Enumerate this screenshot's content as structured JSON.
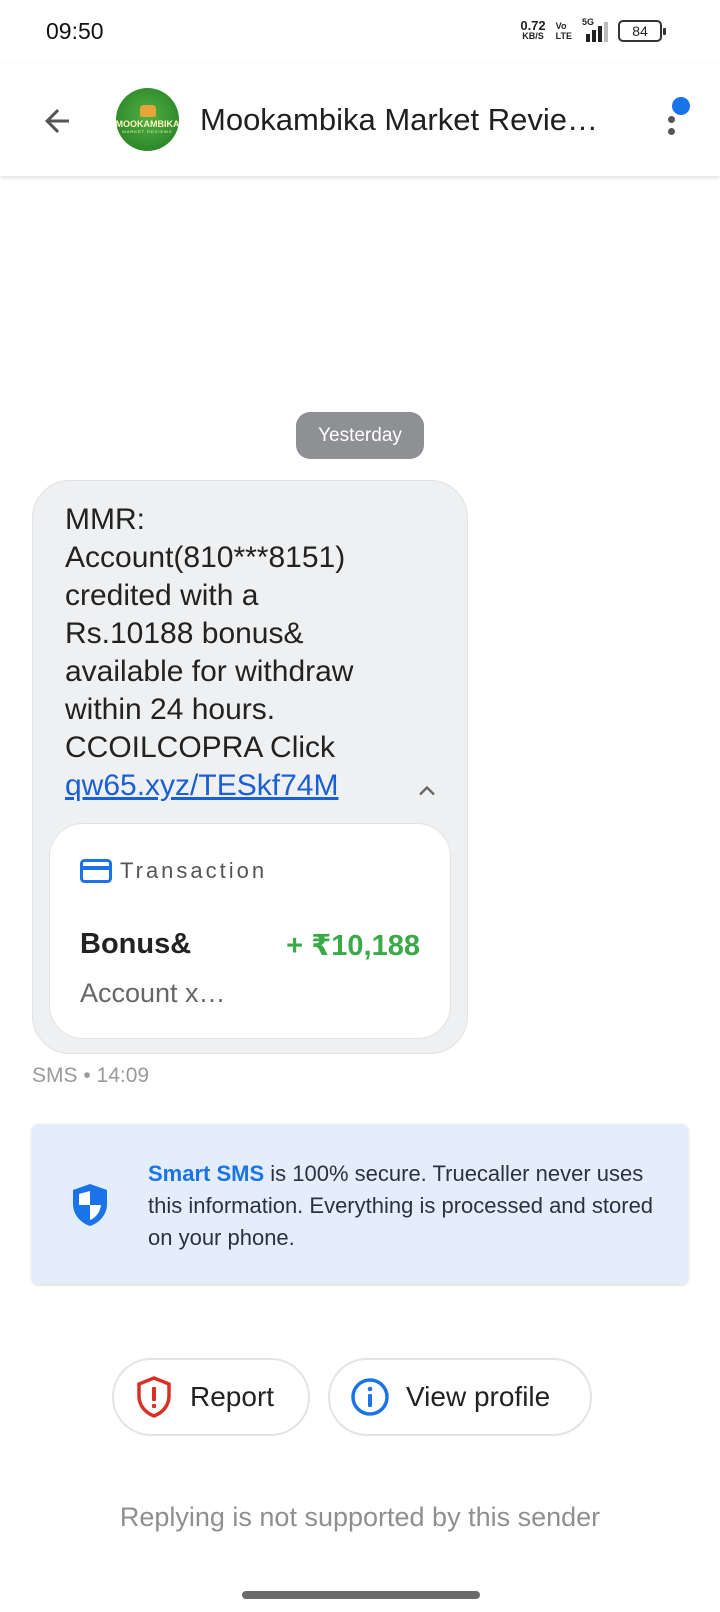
{
  "status_bar": {
    "time": "09:50",
    "net_speed": "0.72",
    "net_unit": "KB/S",
    "volte_top": "Vo",
    "volte_bottom": "LTE",
    "network": "5G",
    "battery": "84"
  },
  "header": {
    "contact_name": "Mookambika Market Revie…",
    "avatar_text": "MOOKAMBIKA",
    "avatar_subtext": "MARKET REVIEWS"
  },
  "conversation": {
    "date_chip": "Yesterday",
    "message": {
      "body_lines": [
        "MMR:",
        "Account(810***8151)",
        "credited with a",
        "Rs.10188 bonus&",
        "available for withdraw",
        "within 24 hours.",
        "CCOILCOPRA Click"
      ],
      "link": "qw65.xyz/TESkf74M",
      "meta": "SMS • 14:09"
    },
    "transaction": {
      "title": "Transaction",
      "label": "Bonus&",
      "amount": "+ ₹10,188",
      "account": "Account x…"
    }
  },
  "info_card": {
    "brand": "Smart SMS",
    "text": " is 100% secure. Truecaller never uses this information. Everything is processed and stored on your phone."
  },
  "actions": {
    "report_label": "Report",
    "profile_label": "View profile"
  },
  "footer": {
    "reply_note": "Replying is not supported by this sender"
  },
  "colors": {
    "accent": "#1a73e8",
    "credit_green": "#3aaa48",
    "report_red": "#d93025",
    "bubble": "#eff0f1",
    "info_bg": "#e4eefb",
    "chip": "#8e9094"
  }
}
